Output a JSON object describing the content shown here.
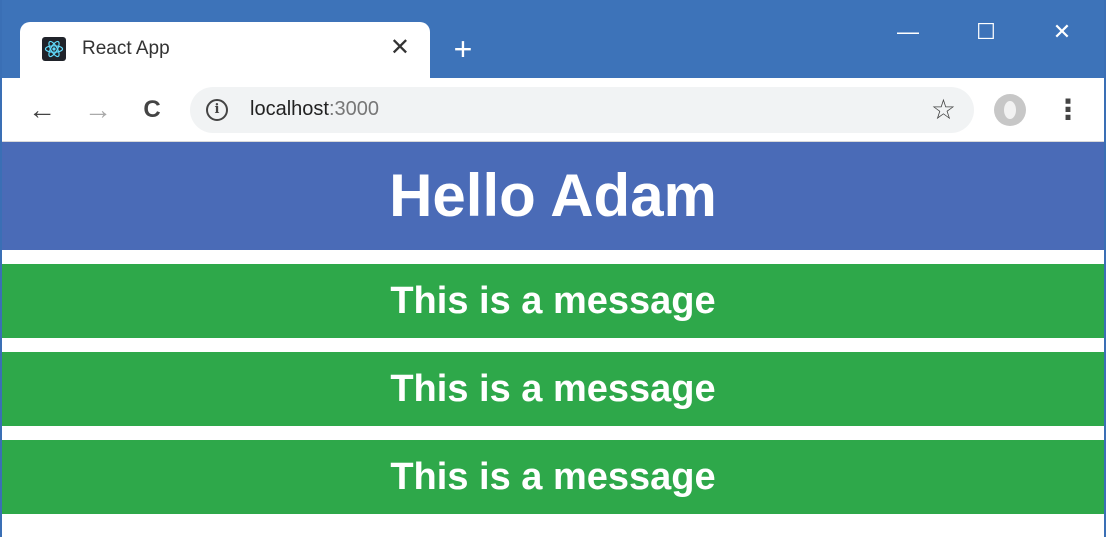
{
  "browser": {
    "tab_title": "React App",
    "tab_close": "✕",
    "new_tab": "+",
    "controls": {
      "minimize": "—",
      "maximize": "☐",
      "close": "✕"
    },
    "nav": {
      "back": "←",
      "forward": "→",
      "reload": "C"
    },
    "url_host": "localhost",
    "url_port": ":3000",
    "info_glyph": "i",
    "bookmark": "☆",
    "menu": "⋮"
  },
  "page": {
    "title": "Hello Adam",
    "messages": [
      "This is a message",
      "This is a message",
      "This is a message"
    ]
  },
  "colors": {
    "titlebar": "#3d73b9",
    "header": "#4a6bb7",
    "message": "#2ea84a"
  }
}
